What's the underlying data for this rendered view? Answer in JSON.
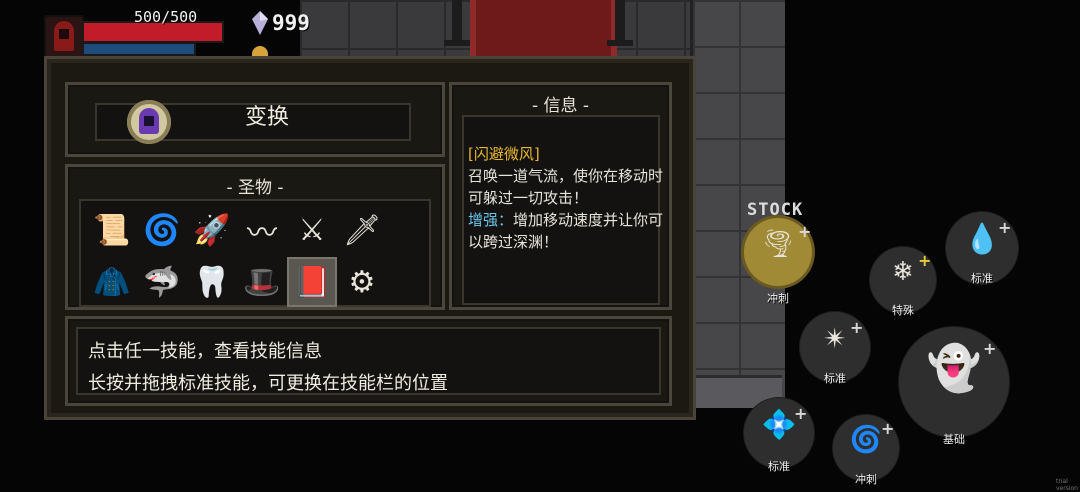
{
  "hud": {
    "hp_text": "500/500",
    "hp_fraction": 1.0,
    "gem_count": "999"
  },
  "skill_header": {
    "name": "变换"
  },
  "relics": {
    "title": "- 圣物 -",
    "items": [
      {
        "icon": "scroll-icon",
        "glyph": "📜",
        "selected": false
      },
      {
        "icon": "coiled-rope-icon",
        "glyph": "🌀",
        "selected": false
      },
      {
        "icon": "rocket-icon",
        "glyph": "🚀",
        "selected": false
      },
      {
        "icon": "spring-icon",
        "glyph": "〰",
        "selected": false
      },
      {
        "icon": "crossed-swords-icon",
        "glyph": "⚔",
        "selected": false
      },
      {
        "icon": "broken-sword-icon",
        "glyph": "🗡",
        "selected": false
      },
      {
        "icon": "green-cloak-icon",
        "glyph": "🧥",
        "selected": false
      },
      {
        "icon": "shark-icon",
        "glyph": "🦈",
        "selected": false
      },
      {
        "icon": "fang-icon",
        "glyph": "🦷",
        "selected": false
      },
      {
        "icon": "red-hat-icon",
        "glyph": "🎩",
        "selected": false
      },
      {
        "icon": "tome-icon",
        "glyph": "📕",
        "selected": true
      },
      {
        "icon": "spiky-gear-icon",
        "glyph": "⚙",
        "selected": false
      }
    ]
  },
  "info": {
    "title": "- 信息 -",
    "skill_name": "[闪避微风]",
    "description": "召唤一道气流，使你在移动时可躲过一切攻击！",
    "enhance_label": "增强：",
    "enhance_text": "增加移动速度并让你可以跨过深渊！"
  },
  "help": {
    "line1": "点击任一技能，查看技能信息",
    "line2": "长按并拖拽标准技能，可更换在技能栏的位置"
  },
  "skill_wheel": {
    "stock_label": "STOCK",
    "orbs": [
      {
        "id": "dash-top",
        "label": "冲刺",
        "icon": "wind-spirit-icon",
        "glyph": "🌪",
        "plus_color": "#d8d8d8"
      },
      {
        "id": "special",
        "label": "特殊",
        "icon": "ice-spiral-icon",
        "glyph": "❄",
        "plus_color": "#e8c840"
      },
      {
        "id": "standard-water",
        "label": "标准",
        "icon": "water-orbs-icon",
        "glyph": "💧",
        "plus_color": "#d8d8d8"
      },
      {
        "id": "standard-void",
        "label": "标准",
        "icon": "void-claw-icon",
        "glyph": "✴",
        "plus_color": "#d8d8d8"
      },
      {
        "id": "basic",
        "label": "基础",
        "icon": "shadow-wraith-icon",
        "glyph": "👻",
        "plus_color": "#d8d8d8"
      },
      {
        "id": "standard-crystal",
        "label": "标准",
        "icon": "crystal-icon",
        "glyph": "💠",
        "plus_color": "#d8d8d8"
      },
      {
        "id": "dash-bottom",
        "label": "冲刺",
        "icon": "void-dash-icon",
        "glyph": "🌀",
        "plus_color": "#d8d8d8"
      }
    ]
  },
  "version_text": "trial version"
}
